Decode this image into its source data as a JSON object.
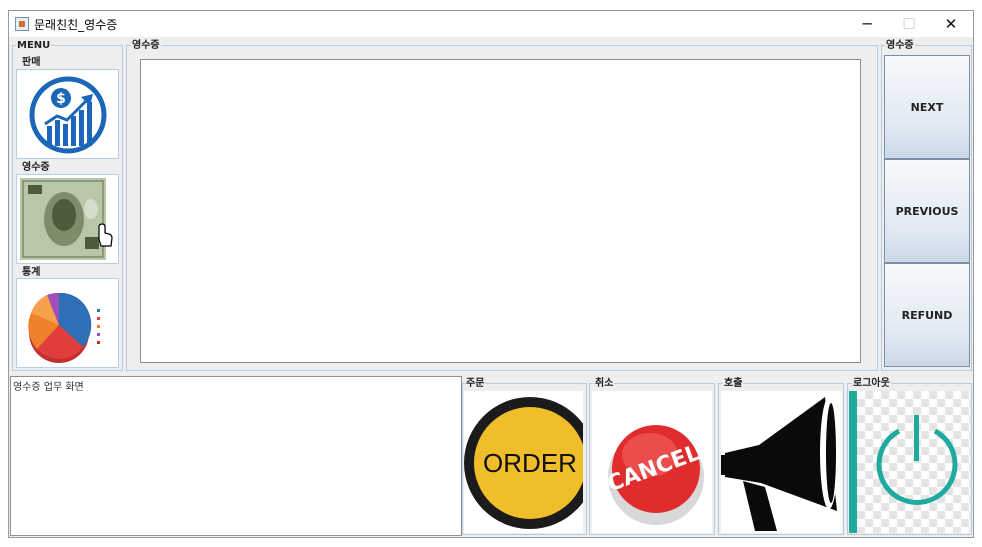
{
  "window": {
    "title": "문래친친_영수증",
    "minimize_glyph": "─",
    "maximize_glyph": "☐",
    "close_glyph": "✕"
  },
  "menu": {
    "group_label": "MENU",
    "items": [
      {
        "label": "판매",
        "icon": "sales-growth-icon"
      },
      {
        "label": "영수증",
        "icon": "dollar-bill-icon"
      },
      {
        "label": "통계",
        "icon": "pie-chart-icon"
      }
    ]
  },
  "main": {
    "group_label": "영수증"
  },
  "right_panel": {
    "group_label": "영수증",
    "buttons": [
      "NEXT",
      "PREVIOUS",
      "REFUND"
    ]
  },
  "status": {
    "text": "영수증 업무 화면"
  },
  "bottom_actions": [
    {
      "label": "주문",
      "icon": "order-icon",
      "icon_text": "ORDER"
    },
    {
      "label": "취소",
      "icon": "cancel-icon",
      "icon_text": "CANCEL"
    },
    {
      "label": "호출",
      "icon": "megaphone-icon"
    },
    {
      "label": "로그아웃",
      "icon": "power-icon"
    }
  ]
}
